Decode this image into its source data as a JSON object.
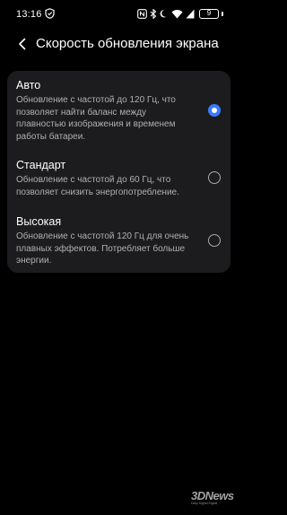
{
  "status_bar": {
    "time": "13:16",
    "battery_level": "9",
    "icons": [
      "shield-icon",
      "nfc-icon",
      "bluetooth-icon",
      "do-not-disturb-moon-icon",
      "wifi-icon",
      "mobile-signal-icon",
      "battery-icon"
    ]
  },
  "header": {
    "title": "Скорость обновления экрана",
    "back_icon": "chevron-left-icon"
  },
  "options": [
    {
      "title": "Авто",
      "description": "Обновление с частотой до 120 Гц, что позволяет найти баланс между плавностью изображения и временем работы батареи.",
      "selected": true
    },
    {
      "title": "Стандарт",
      "description": "Обновление с частотой до 60 Гц, что позволяет снизить энергопотребление.",
      "selected": false
    },
    {
      "title": "Высокая",
      "description": "Обновление с частотой 120 Гц для очень плавных эффектов. Потребляет больше энергии.",
      "selected": false
    }
  ],
  "colors": {
    "background": "#000000",
    "card": "#1c1c1e",
    "accent": "#3c7bff",
    "secondary_text": "#b0b0b0"
  },
  "watermark": {
    "logo": "3DNews",
    "subtitle": "Daily Digital Digest"
  }
}
